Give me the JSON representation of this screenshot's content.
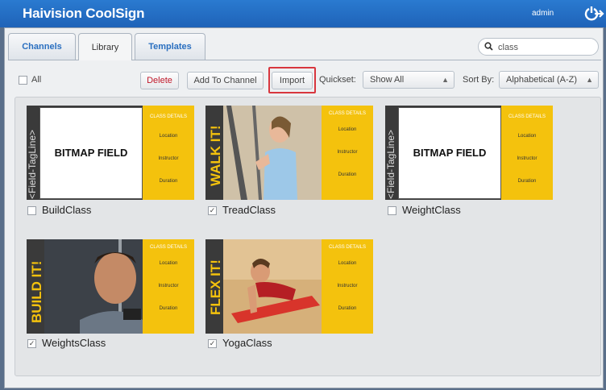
{
  "header": {
    "brand": "Haivision CoolSign",
    "user": "admin"
  },
  "tabs": [
    {
      "label": "Channels",
      "active": false
    },
    {
      "label": "Library",
      "active": true
    },
    {
      "label": "Templates",
      "active": false
    }
  ],
  "search": {
    "value": "class"
  },
  "toolbar": {
    "select_all_label": "All",
    "delete_label": "Delete",
    "add_to_channel_label": "Add To Channel",
    "import_label": "Import",
    "quickset_label": "Quickset:",
    "quickset_value": "Show All",
    "sortby_label": "Sort By:",
    "sortby_value": "Alphabetical (A-Z)"
  },
  "items": [
    {
      "name": "BuildClass",
      "checked": false,
      "banner": "<Field-TagLine>",
      "type": "bitmap",
      "bitmap_text": "BITMAP FIELD"
    },
    {
      "name": "TreadClass",
      "checked": true,
      "banner": "WALK IT!",
      "type": "photo"
    },
    {
      "name": "WeightClass",
      "checked": false,
      "banner": "<Field-TagLine>",
      "type": "bitmap",
      "bitmap_text": "BITMAP FIELD"
    },
    {
      "name": "WeightsClass",
      "checked": true,
      "banner": "BUILD IT!",
      "type": "photo"
    },
    {
      "name": "YogaClass",
      "checked": true,
      "banner": "FLEX IT!",
      "type": "photo"
    }
  ],
  "class_details": {
    "heading": "CLASS DETAILS",
    "location_label": "Location",
    "instructor_label": "Instructor",
    "duration_label": "Duration"
  },
  "colors": {
    "header_blue": "#1f63b8",
    "accent_yellow": "#f4c20d",
    "highlight_red": "#d8363e"
  }
}
